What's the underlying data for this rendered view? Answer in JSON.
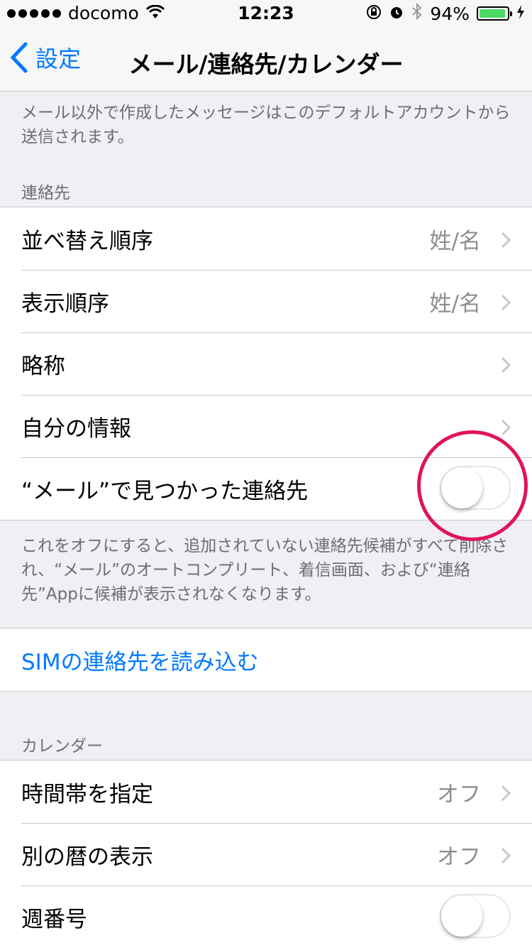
{
  "status_bar": {
    "carrier": "docomo",
    "time": "12:23",
    "battery_percent": "94%",
    "battery_level": 0.94,
    "icons": [
      "signal-dots",
      "wifi-icon",
      "rotation-lock-icon",
      "alarm-icon",
      "bluetooth-icon",
      "battery-icon",
      "charging-icon"
    ]
  },
  "nav": {
    "back_label": "設定",
    "title": "メール/連絡先/カレンダー"
  },
  "top_footer": "メール以外で作成したメッセージはこのデフォルトアカウントから送信されます。",
  "contacts": {
    "header": "連絡先",
    "rows": [
      {
        "label": "並べ替え順序",
        "value": "姓/名"
      },
      {
        "label": "表示順序",
        "value": "姓/名"
      },
      {
        "label": "略称",
        "value": ""
      },
      {
        "label": "自分の情報",
        "value": ""
      },
      {
        "label": "“メール”で見つかった連絡先",
        "toggle": false
      }
    ],
    "footer": "これをオフにすると、追加されていない連絡先候補がすべて削除され、“メール”のオートコンプリート、着信画面、および“連絡先”Appに候補が表示されなくなります。"
  },
  "sim": {
    "label": "SIMの連絡先を読み込む"
  },
  "calendar": {
    "header": "カレンダー",
    "rows": [
      {
        "label": "時間帯を指定",
        "value": "オフ"
      },
      {
        "label": "別の暦の表示",
        "value": "オフ"
      },
      {
        "label": "週番号",
        "toggle": false
      }
    ]
  },
  "colors": {
    "accent": "#007aff",
    "background": "#efeff4",
    "highlight_circle": "#e0135c",
    "battery": "#4cd964"
  }
}
